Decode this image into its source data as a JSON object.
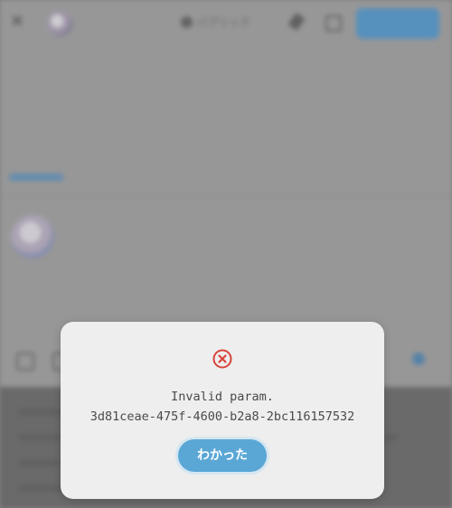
{
  "dialog": {
    "icon": "error-circle-x-icon",
    "message_line1": "Invalid param.",
    "message_line2": "3d81ceae-475f-4600-b2a8-2bc116157532",
    "ok_label": "わかった",
    "accent_color": "#5aa7d6",
    "error_color": "#d9443a"
  },
  "background": {
    "visibility_label": "パブリック"
  }
}
